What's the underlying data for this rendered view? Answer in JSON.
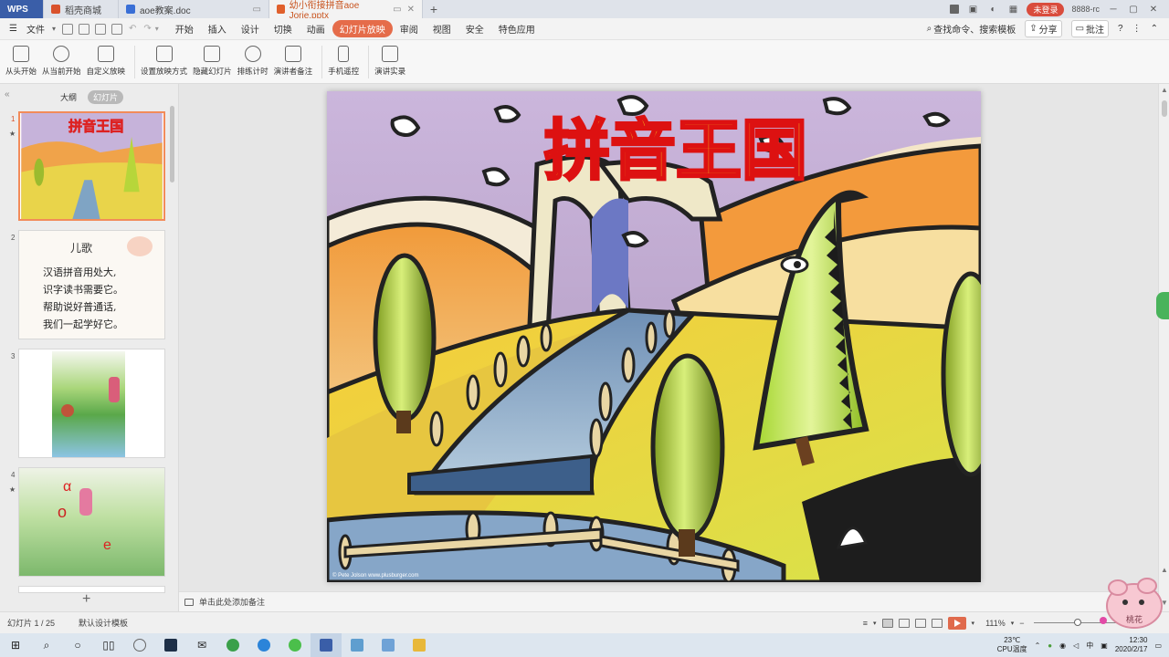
{
  "tabs": [
    {
      "label": "WPS",
      "kind": "wps"
    },
    {
      "label": "稻壳商城",
      "kind": "home",
      "color": "#d9522c"
    },
    {
      "label": "aoe教案.doc",
      "kind": "doc",
      "color": "#3a6fd6"
    },
    {
      "label": "幼小衔接拼音aoe Jorie.pptx",
      "kind": "active",
      "color": "#e0602c"
    }
  ],
  "titlebar": {
    "new_tab": "+",
    "login": "未登录",
    "user_text": "8888-rc",
    "min": "─",
    "max": "▢",
    "close": "✕"
  },
  "menu": {
    "file": "文件",
    "items": [
      "开始",
      "插入",
      "设计",
      "切换",
      "动画",
      "幻灯片放映",
      "审阅",
      "视图",
      "安全",
      "特色应用"
    ],
    "active": "幻灯片放映",
    "search": "查找命令、搜索模板",
    "share": "分享",
    "comment": "批注",
    "help": "?"
  },
  "ribbon": [
    {
      "label": "从头开始",
      "icon": "play-from-start-icon"
    },
    {
      "label": "从当前开始",
      "icon": "play-from-current-icon"
    },
    {
      "label": "自定义放映",
      "icon": "custom-show-icon"
    },
    {
      "label": "设置放映方式",
      "icon": "setup-show-icon"
    },
    {
      "label": "隐藏幻灯片",
      "icon": "hide-slide-icon"
    },
    {
      "label": "排练计时",
      "icon": "rehearse-timing-icon"
    },
    {
      "label": "演讲者备注",
      "icon": "speaker-notes-icon"
    },
    {
      "label": "手机遥控",
      "icon": "phone-remote-icon"
    },
    {
      "label": "演讲实录",
      "icon": "record-icon"
    }
  ],
  "left_panel": {
    "tab_outline": "大纲",
    "tab_slides": "幻灯片",
    "add": "+",
    "slides": [
      {
        "num": "1",
        "star": "★",
        "title": "拼音王国"
      },
      {
        "num": "2",
        "star": "",
        "poem_title": "儿歌",
        "poem_lines": [
          "汉语拼音用处大,",
          "识字读书需要它。",
          "帮助说好普通话,",
          "我们一起学好它。"
        ]
      },
      {
        "num": "3",
        "star": ""
      },
      {
        "num": "4",
        "star": "★",
        "letters": [
          "α",
          "o",
          "e"
        ]
      }
    ]
  },
  "slide": {
    "title": "拼音王国",
    "credit": "© Pete Jolson   www.plusburger.com"
  },
  "notes_placeholder": "单击此处添加备注",
  "status": {
    "slide_counter": "幻灯片 1 / 25",
    "template": "默认设计模板",
    "zoom": "111%",
    "zoom_minus": "−",
    "zoom_plus": "+"
  },
  "taskbar": {
    "temp": "23℃",
    "cpu": "CPU温度",
    "time": "12:30",
    "date": "2020/2/17",
    "mascot_text": "桃花"
  }
}
